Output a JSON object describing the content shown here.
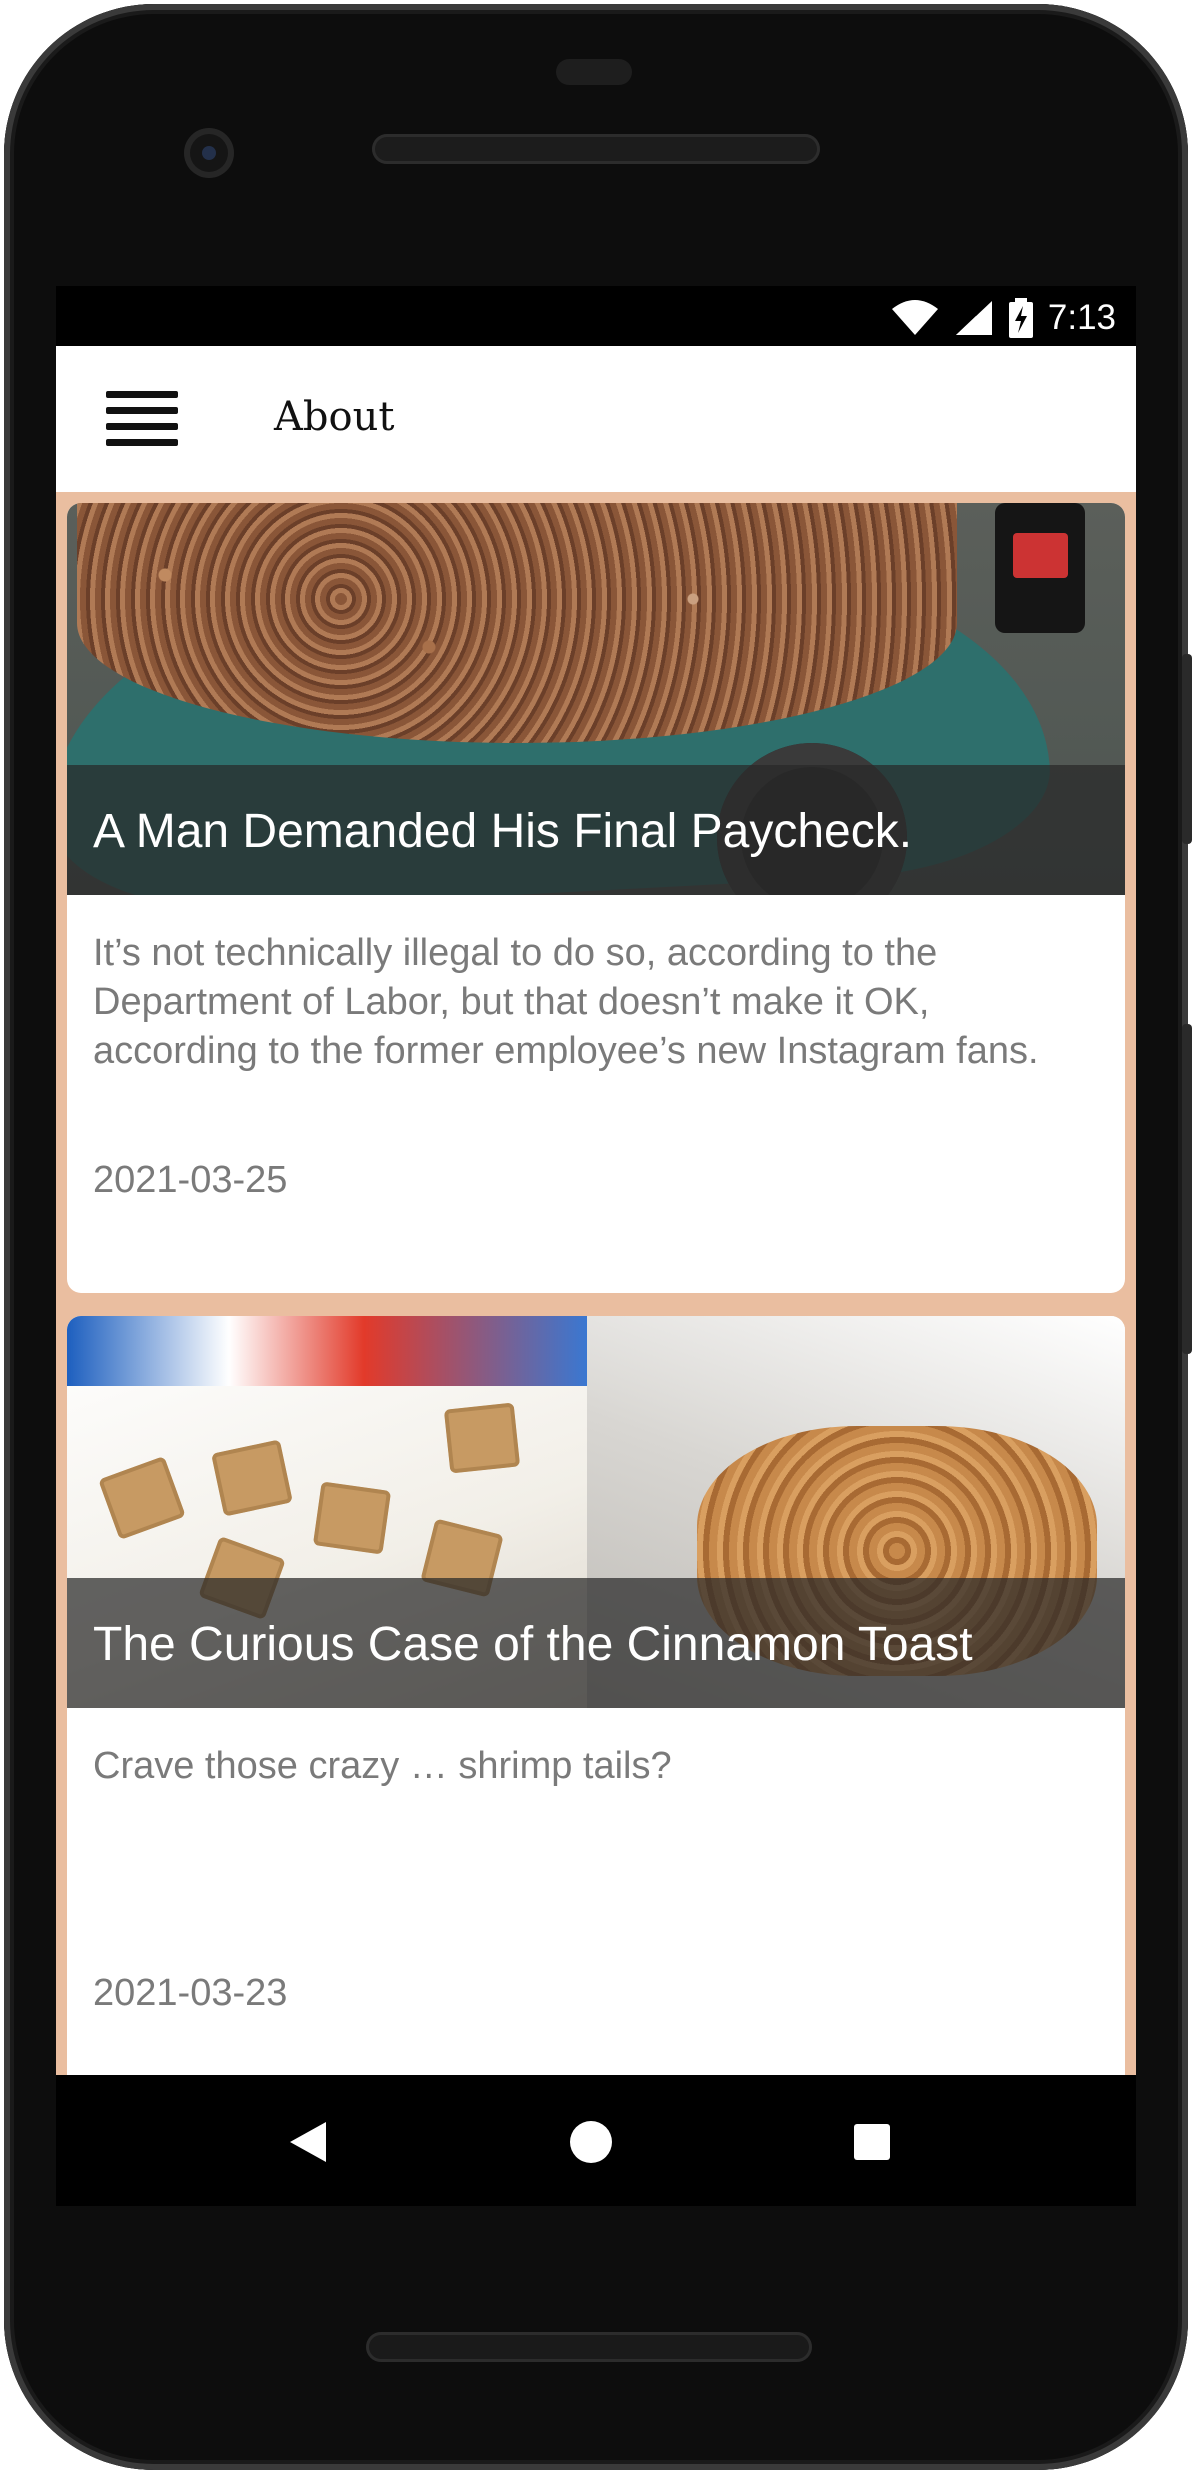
{
  "status_bar": {
    "time": "7:13",
    "icons": [
      "wifi-icon",
      "signal-icon",
      "battery-charging-icon"
    ]
  },
  "app_bar": {
    "menu_icon": "hamburger-menu-icon",
    "title": "About"
  },
  "colors": {
    "background": "#eabea0",
    "card": "#ffffff",
    "title_band": "#282828",
    "body_text": "#7a7a7a"
  },
  "articles": [
    {
      "title": "A Man Demanded His Final Paycheck.",
      "description": "It’s not technically illegal to do so, according to the Department of Labor, but that doesn’t make it OK, according to the former employee’s new Instagram fans.",
      "date": "2021-03-25"
    },
    {
      "title": "The Curious Case of the Cinnamon Toast",
      "description": "Crave those crazy … shrimp tails?",
      "date": "2021-03-23"
    }
  ],
  "nav_bar": {
    "back_icon": "back-triangle-icon",
    "home_icon": "home-circle-icon",
    "recents_icon": "recents-square-icon"
  }
}
